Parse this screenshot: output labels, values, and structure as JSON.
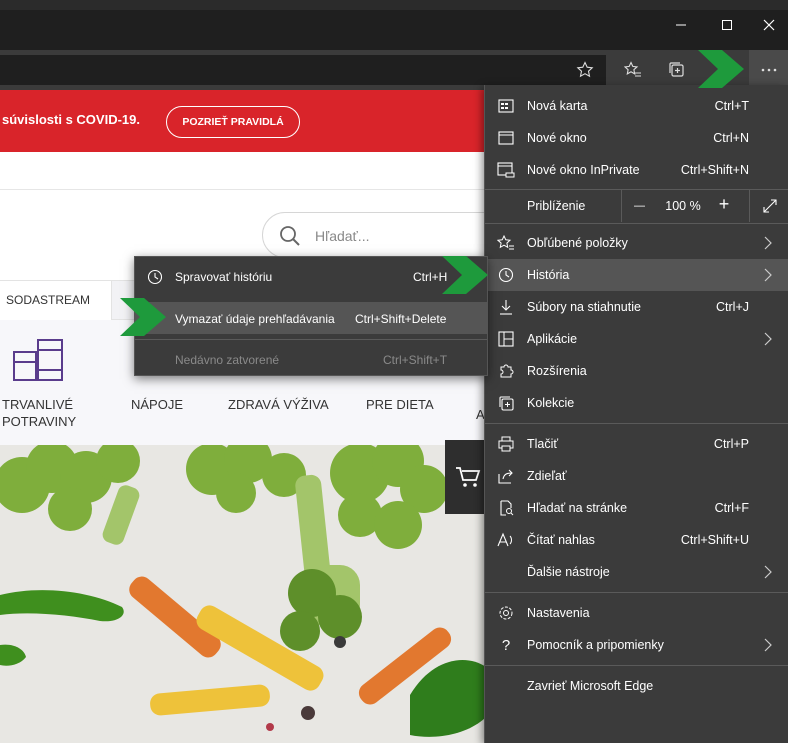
{
  "banner": {
    "text": "súvislosti s COVID-19.",
    "button": "POZRIEŤ PRAVIDLÁ"
  },
  "search": {
    "placeholder": "Hľadať..."
  },
  "category_tab": "SODASTREAM",
  "categories": [
    {
      "line1": "TRVANLIVÉ",
      "line2": "POTRAVINY"
    },
    {
      "line1": "NÁPOJE"
    },
    {
      "line1": "ZDRAVÁ VÝŽIVA"
    },
    {
      "line1": "PRE DIETA"
    }
  ],
  "category_partial": "A",
  "menu": {
    "items": [
      {
        "label": "Nová karta",
        "shortcut": "Ctrl+T",
        "icon": "new-tab-icon"
      },
      {
        "label": "Nové okno",
        "shortcut": "Ctrl+N",
        "icon": "new-window-icon"
      },
      {
        "label": "Nové okno InPrivate",
        "shortcut": "Ctrl+Shift+N",
        "icon": "inprivate-icon"
      }
    ],
    "zoom": {
      "label": "Priblíženie",
      "minus": "—",
      "value": "100 %",
      "plus": "+"
    },
    "items2": [
      {
        "label": "Obľúbené položky",
        "shortcut": "",
        "submenu": true,
        "icon": "favorites-icon"
      },
      {
        "label": "História",
        "shortcut": "",
        "submenu": true,
        "icon": "history-icon"
      },
      {
        "label": "Súbory na stiahnutie",
        "shortcut": "Ctrl+J",
        "icon": "download-icon"
      },
      {
        "label": "Aplikácie",
        "shortcut": "",
        "submenu": true,
        "icon": "apps-icon"
      },
      {
        "label": "Rozšírenia",
        "shortcut": "",
        "icon": "extensions-icon"
      },
      {
        "label": "Kolekcie",
        "shortcut": "",
        "icon": "collections-icon"
      }
    ],
    "items3": [
      {
        "label": "Tlačiť",
        "shortcut": "Ctrl+P",
        "icon": "print-icon"
      },
      {
        "label": "Zdieľať",
        "shortcut": "",
        "icon": "share-icon"
      },
      {
        "label": "Hľadať na stránke",
        "shortcut": "Ctrl+F",
        "icon": "find-icon"
      },
      {
        "label": "Čítať nahlas",
        "shortcut": "Ctrl+Shift+U",
        "icon": "read-aloud-icon"
      },
      {
        "label": "Ďalšie nástroje",
        "shortcut": "",
        "submenu": true,
        "icon": ""
      }
    ],
    "items4": [
      {
        "label": "Nastavenia",
        "shortcut": "",
        "icon": "settings-icon"
      },
      {
        "label": "Pomocník a pripomienky",
        "shortcut": "",
        "submenu": true,
        "icon": "help-icon"
      }
    ],
    "close": "Zavrieť Microsoft Edge"
  },
  "history_submenu": {
    "items": [
      {
        "label": "Spravovať históriu",
        "shortcut": "Ctrl+H"
      },
      {
        "label": "Vymazať údaje prehľadávania",
        "shortcut": "Ctrl+Shift+Delete"
      },
      {
        "label": "Nedávno zatvorené",
        "shortcut": "Ctrl+Shift+T"
      }
    ]
  },
  "colors": {
    "banner": "#d9242a",
    "menu_bg": "#3b3b3b",
    "highlight": "#555555",
    "arrow": "#1e9a3c"
  }
}
